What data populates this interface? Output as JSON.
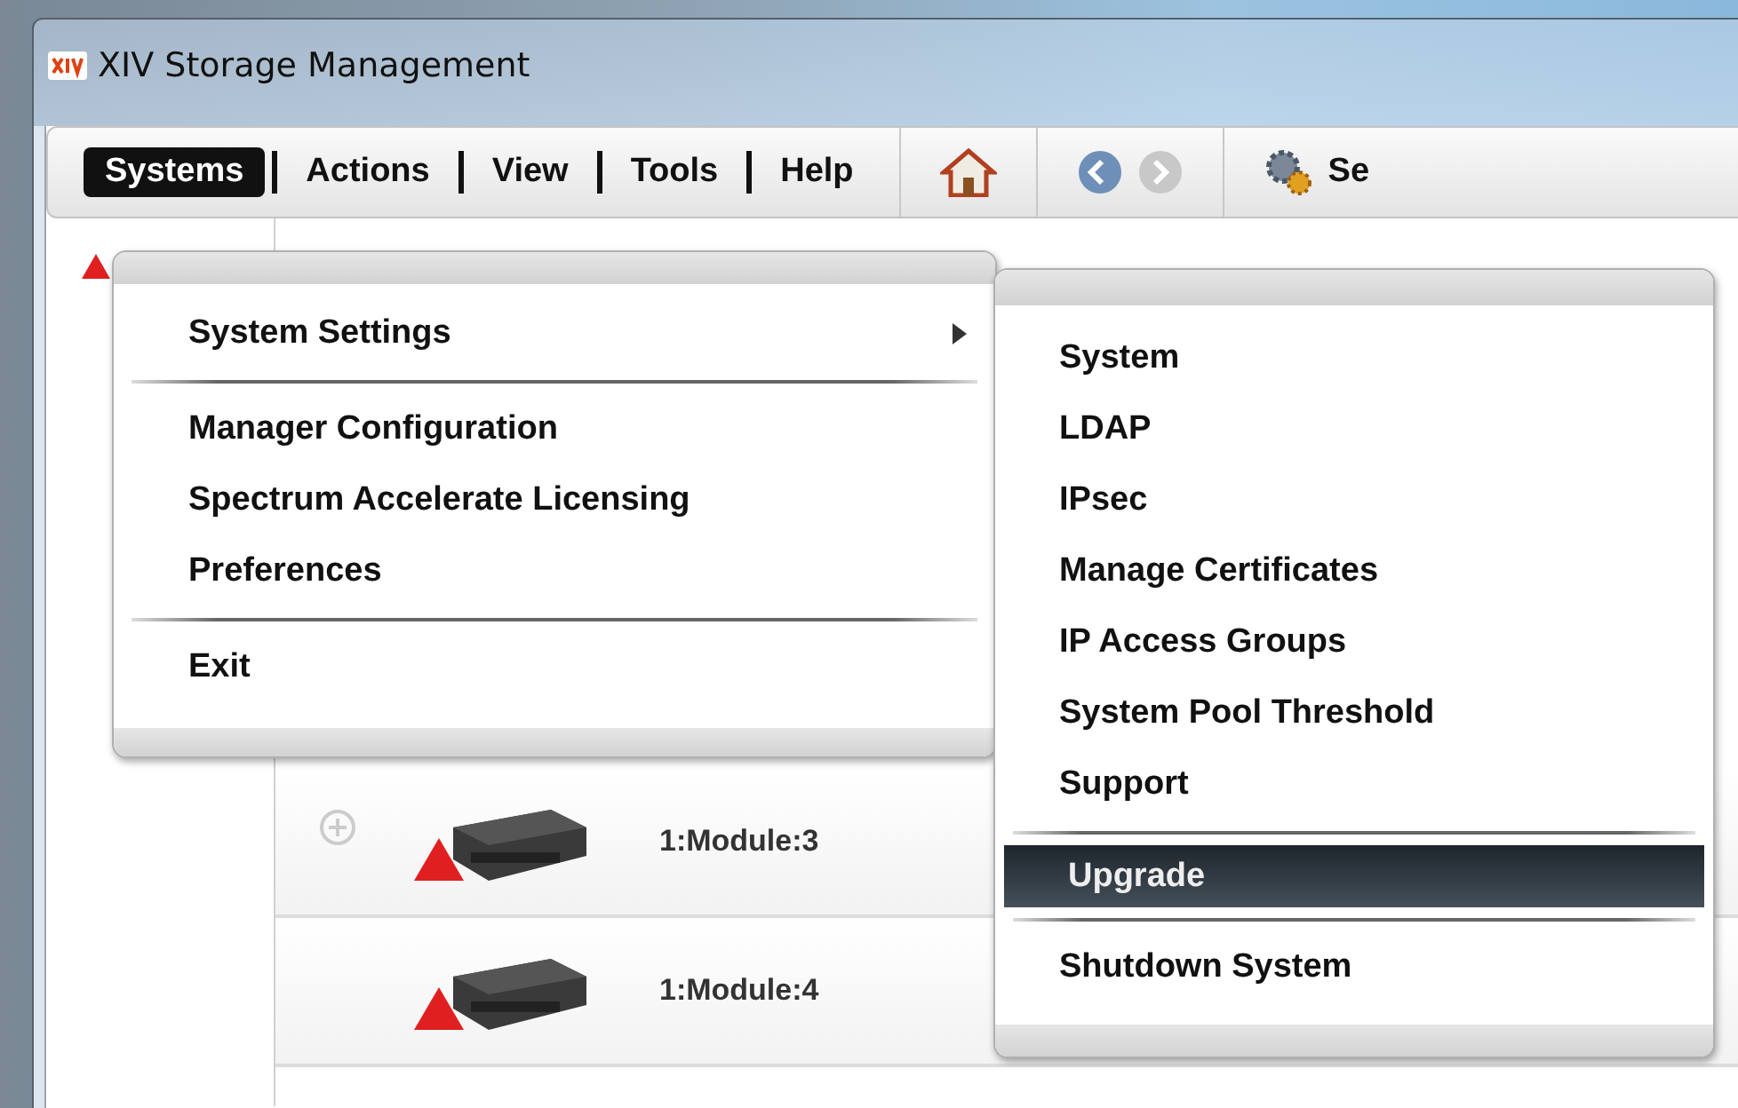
{
  "window": {
    "title": "XIV Storage Management"
  },
  "menu_bar": {
    "items": [
      {
        "label": "Systems",
        "selected": true
      },
      {
        "label": "Actions",
        "selected": false
      },
      {
        "label": "View",
        "selected": false
      },
      {
        "label": "Tools",
        "selected": false
      },
      {
        "label": "Help",
        "selected": false
      }
    ]
  },
  "toolbar": {
    "nav": [
      {
        "kind": "back",
        "disabled": false
      },
      {
        "kind": "forward",
        "disabled": true
      }
    ],
    "settings_label": "Se"
  },
  "systems_menu": {
    "items": [
      {
        "kind": "submenu",
        "label": "System Settings"
      },
      {
        "kind": "separator"
      },
      {
        "kind": "item",
        "label": "Manager Configuration"
      },
      {
        "kind": "item",
        "label": "Spectrum Accelerate Licensing"
      },
      {
        "kind": "item",
        "label": "Preferences"
      },
      {
        "kind": "separator"
      },
      {
        "kind": "item",
        "label": "Exit"
      }
    ]
  },
  "system_settings_menu": {
    "items": [
      {
        "kind": "item",
        "label": "System",
        "selected": false
      },
      {
        "kind": "item",
        "label": "LDAP",
        "selected": false
      },
      {
        "kind": "item",
        "label": "IPsec",
        "selected": false
      },
      {
        "kind": "item",
        "label": "Manage Certificates",
        "selected": false
      },
      {
        "kind": "item",
        "label": "IP Access Groups",
        "selected": false
      },
      {
        "kind": "item",
        "label": "System Pool Threshold",
        "selected": false
      },
      {
        "kind": "item",
        "label": "Support",
        "selected": false
      },
      {
        "kind": "separator"
      },
      {
        "kind": "item",
        "label": "Upgrade",
        "selected": true
      },
      {
        "kind": "separator"
      },
      {
        "kind": "item",
        "label": "Shutdown System",
        "selected": false
      }
    ]
  },
  "modules": [
    {
      "name": "1:Module:3",
      "warning": true,
      "expandable": true
    },
    {
      "name": "1:Module:4",
      "warning": true,
      "expandable": false
    }
  ]
}
